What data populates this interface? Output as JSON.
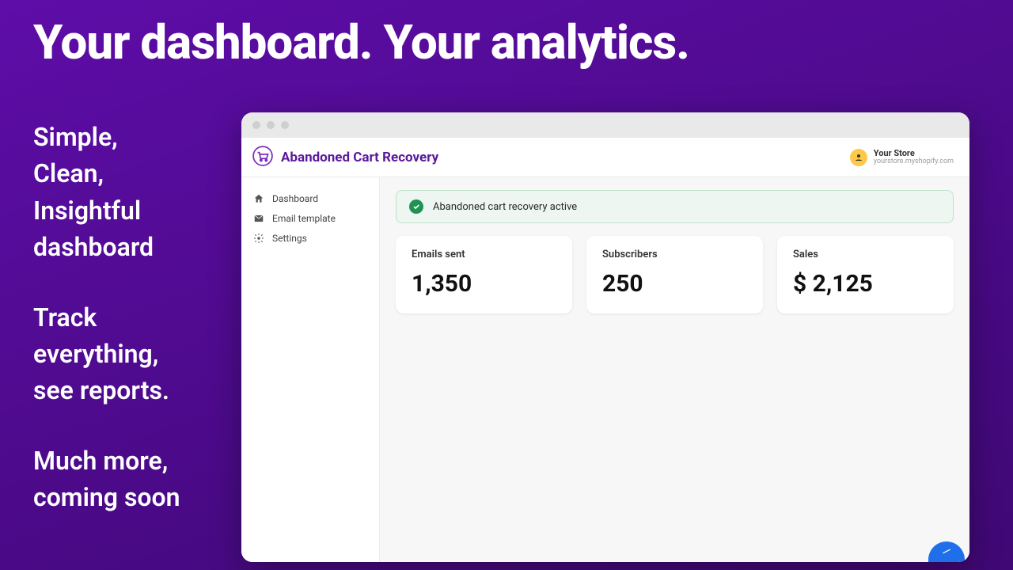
{
  "hero": {
    "title": "Your dashboard. Your analytics."
  },
  "copy": {
    "block1_l1": "Simple,",
    "block1_l2": "Clean,",
    "block1_l3": "Insightful",
    "block1_l4": "dashboard",
    "block2_l1": "Track",
    "block2_l2": "everything,",
    "block2_l3": "see reports.",
    "block3_l1": "Much more,",
    "block3_l2": "coming soon"
  },
  "app": {
    "title": "Abandoned Cart Recovery",
    "store": {
      "name": "Your Store",
      "url": "yourstore.myshopify.com"
    }
  },
  "sidebar": {
    "items": [
      {
        "label": "Dashboard"
      },
      {
        "label": "Email template"
      },
      {
        "label": "Settings"
      }
    ]
  },
  "status": {
    "text": "Abandoned cart recovery active"
  },
  "cards": {
    "emails": {
      "label": "Emails sent",
      "value": "1,350"
    },
    "subscribers": {
      "label": "Subscribers",
      "value": "250"
    },
    "sales": {
      "label": "Sales",
      "value": "$ 2,125"
    }
  }
}
